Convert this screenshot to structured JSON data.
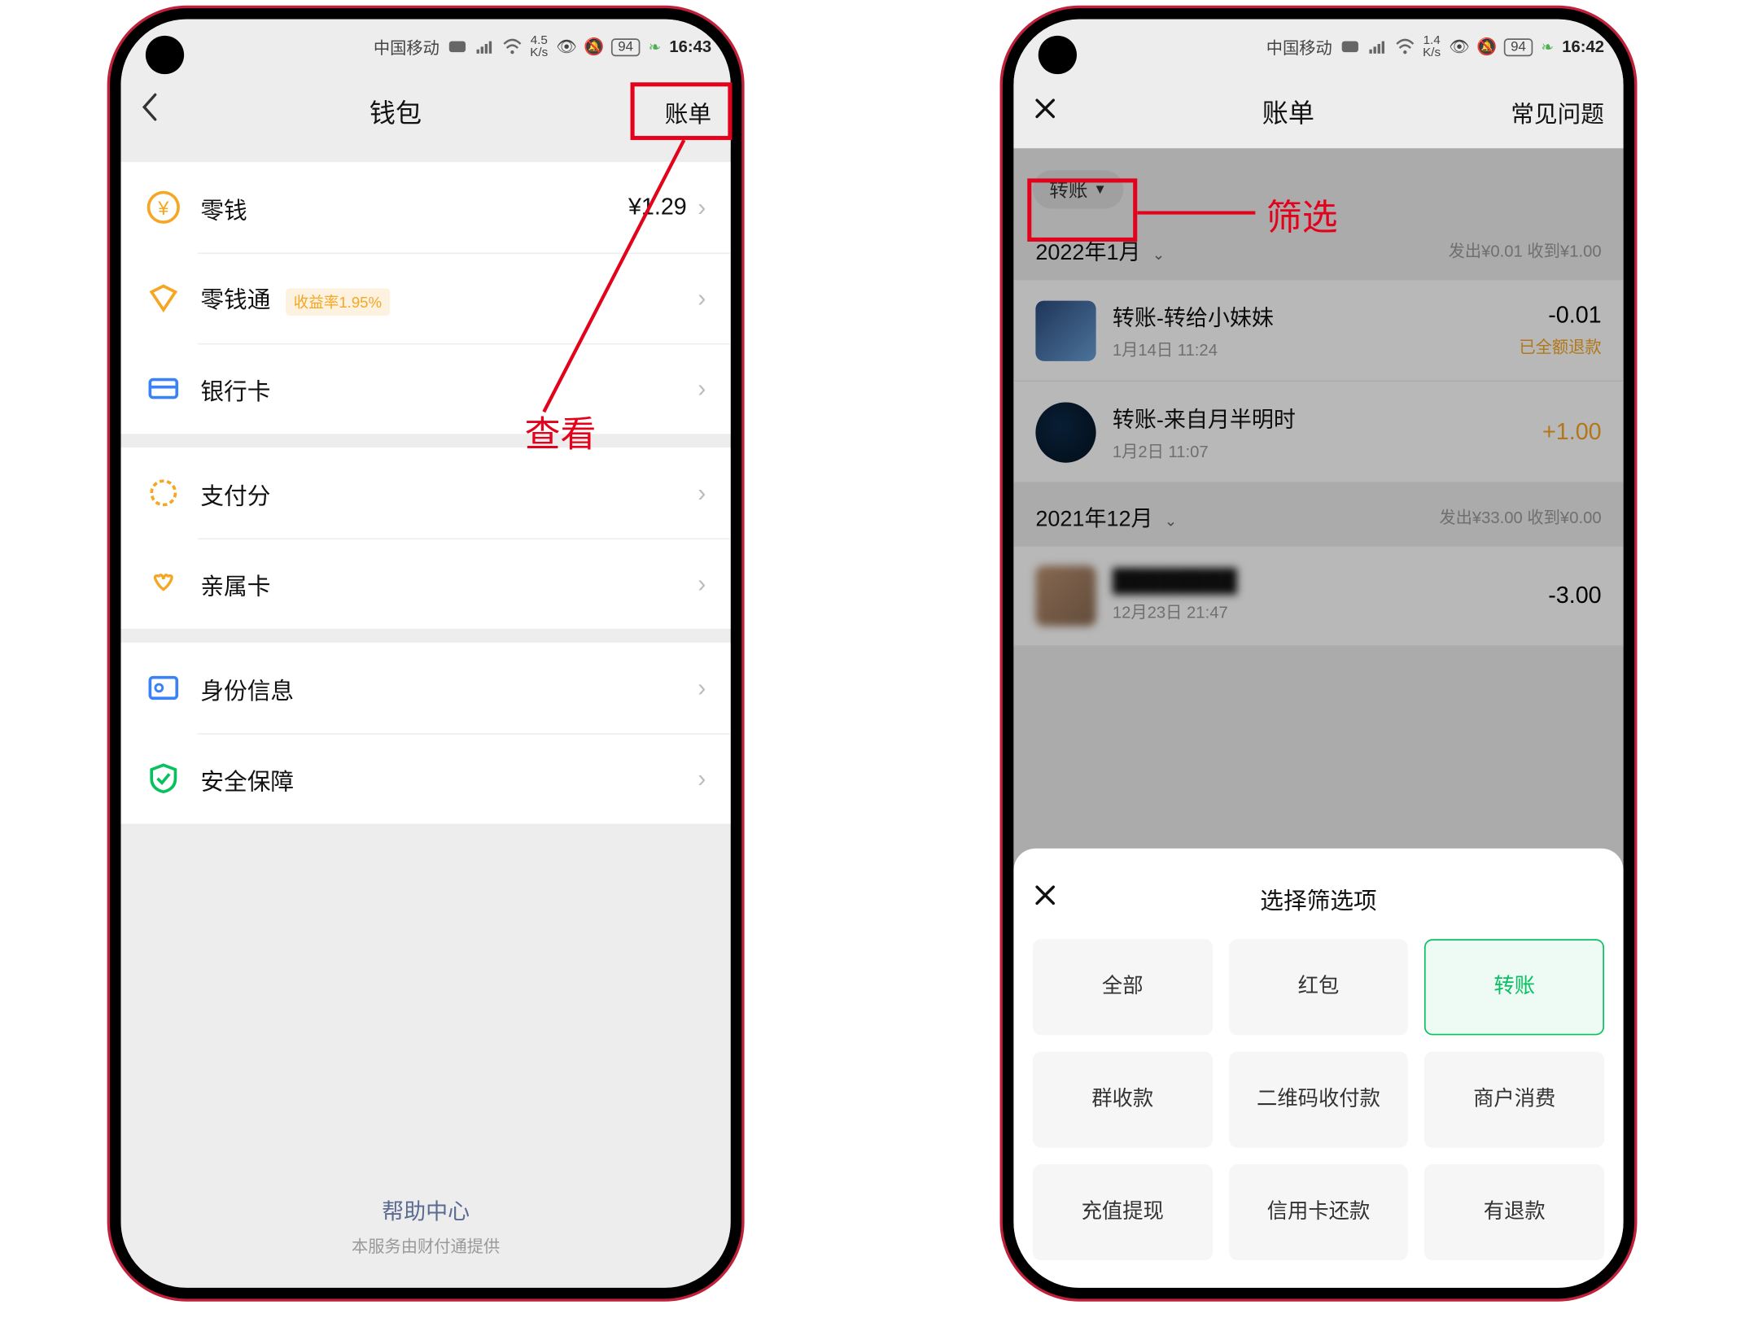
{
  "left": {
    "status": {
      "carrier": "中国移动",
      "speed_top": "4.5",
      "speed_bot": "K/s",
      "batt": "94",
      "time": "16:43"
    },
    "nav": {
      "title": "钱包",
      "action": "账单"
    },
    "rows": {
      "balance": {
        "label": "零钱",
        "value": "¥1.29"
      },
      "lct": {
        "label": "零钱通",
        "badge": "收益率1.95%"
      },
      "bank": {
        "label": "银行卡"
      },
      "score": {
        "label": "支付分"
      },
      "family": {
        "label": "亲属卡"
      },
      "identity": {
        "label": "身份信息"
      },
      "security": {
        "label": "安全保障"
      }
    },
    "footer": {
      "link": "帮助中心",
      "note": "本服务由财付通提供"
    }
  },
  "right": {
    "status": {
      "carrier": "中国移动",
      "speed_top": "1.4",
      "speed_bot": "K/s",
      "batt": "94",
      "time": "16:42"
    },
    "nav": {
      "title": "账单",
      "action": "常见问题"
    },
    "filter_chip": "转账",
    "months": {
      "m1": {
        "label": "2022年1月",
        "summary": "发出¥0.01  收到¥1.00"
      },
      "m2": {
        "label": "2021年12月",
        "summary": "发出¥33.00  收到¥0.00"
      }
    },
    "txns": {
      "t1": {
        "title": "转账-转给小妹妹",
        "time": "1月14日 11:24",
        "amount": "-0.01",
        "sub": "已全额退款"
      },
      "t2": {
        "title": "转账-来自月半明时",
        "time": "1月2日 11:07",
        "amount": "+1.00"
      },
      "t3": {
        "title": "████████",
        "time": "12月23日 21:47",
        "amount": "-3.00"
      }
    },
    "sheet": {
      "title": "选择筛选项",
      "opts": [
        "全部",
        "红包",
        "转账",
        "群收款",
        "二维码收付款",
        "商户消费",
        "充值提现",
        "信用卡还款",
        "有退款"
      ]
    }
  },
  "anno": {
    "view": "查看",
    "filter": "筛选"
  },
  "colors": {
    "neg": "#111",
    "pos": "#f5a623",
    "accent": "#07c160",
    "red": "#e3021b"
  }
}
